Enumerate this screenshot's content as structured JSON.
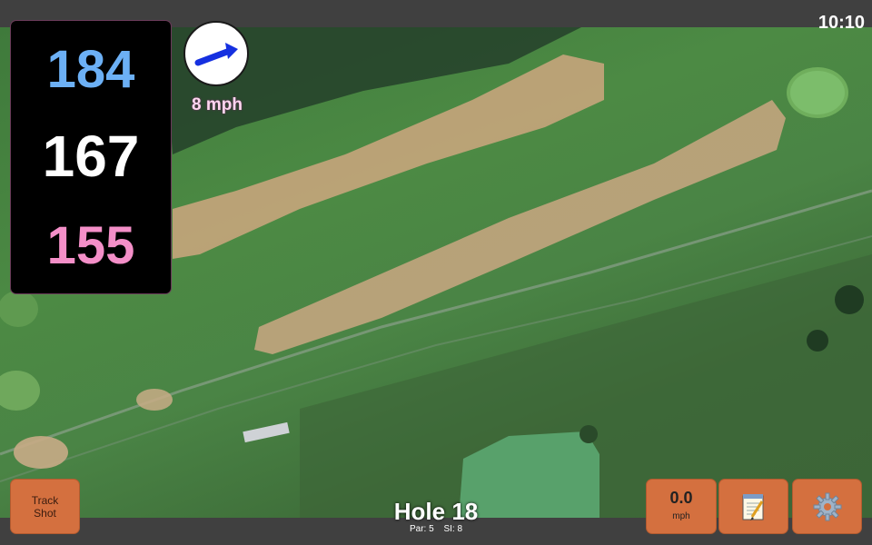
{
  "status": {
    "time": "10:10"
  },
  "distances": {
    "back": "184",
    "middle": "167",
    "front": "155"
  },
  "wind": {
    "speed_text": "8 mph",
    "arrow_icon": "arrow-right-up-icon",
    "arrow_color": "#1530e0"
  },
  "hole": {
    "title": "Hole 18",
    "par": "Par: 5",
    "stroke_index": "SI: 8"
  },
  "buttons": {
    "track_shot_line1": "Track",
    "track_shot_line2": "Shot",
    "speed_value": "0.0",
    "speed_unit": "mph",
    "notes_icon": "notepad-icon",
    "settings_icon": "gear-icon"
  },
  "colors": {
    "button_bg": "#d4703f",
    "back_distance": "#6cb0f5",
    "middle_distance": "#ffffff",
    "front_distance": "#f48fc8"
  }
}
